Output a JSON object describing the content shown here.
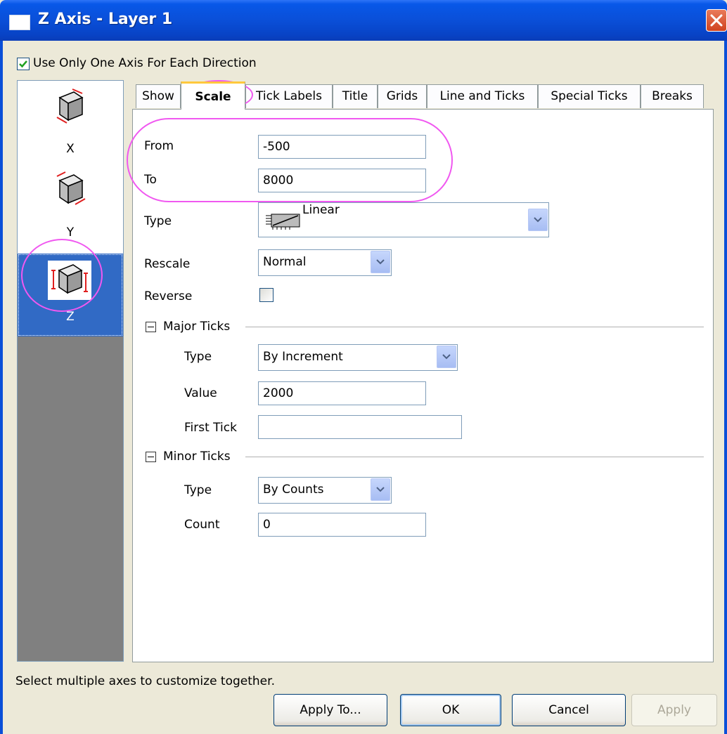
{
  "window": {
    "title": "Z Axis - Layer 1"
  },
  "options": {
    "one_axis_label": "Use Only One Axis For Each Direction",
    "one_axis_checked": true
  },
  "axes": [
    {
      "label": "X",
      "icon": "axis-x-cube-icon"
    },
    {
      "label": "Y",
      "icon": "axis-y-cube-icon"
    },
    {
      "label": "Z",
      "icon": "axis-z-cube-icon",
      "selected": true
    }
  ],
  "tabs": [
    "Show",
    "Scale",
    "Tick Labels",
    "Title",
    "Grids",
    "Line and Ticks",
    "Special Ticks",
    "Breaks"
  ],
  "active_tab": "Scale",
  "scale": {
    "from_label": "From",
    "from_value": "-500",
    "to_label": "To",
    "to_value": "8000",
    "type_label": "Type",
    "type_value": "Linear",
    "type_icon": "linear-scale-icon",
    "rescale_label": "Rescale",
    "rescale_value": "Normal",
    "reverse_label": "Reverse",
    "reverse_checked": false
  },
  "major_ticks": {
    "header": "Major Ticks",
    "type_label": "Type",
    "type_value": "By Increment",
    "value_label": "Value",
    "value_value": "2000",
    "first_tick_label": "First Tick",
    "first_tick_value": ""
  },
  "minor_ticks": {
    "header": "Minor Ticks",
    "type_label": "Type",
    "type_value": "By Counts",
    "count_label": "Count",
    "count_value": "0"
  },
  "status_text": "Select multiple axes to customize together.",
  "buttons": {
    "apply_to": "Apply To...",
    "ok": "OK",
    "cancel": "Cancel",
    "apply": "Apply"
  },
  "colors": {
    "highlight": "#f058f0",
    "selection": "#316ac5",
    "titlebar": "#0a4fd8"
  }
}
